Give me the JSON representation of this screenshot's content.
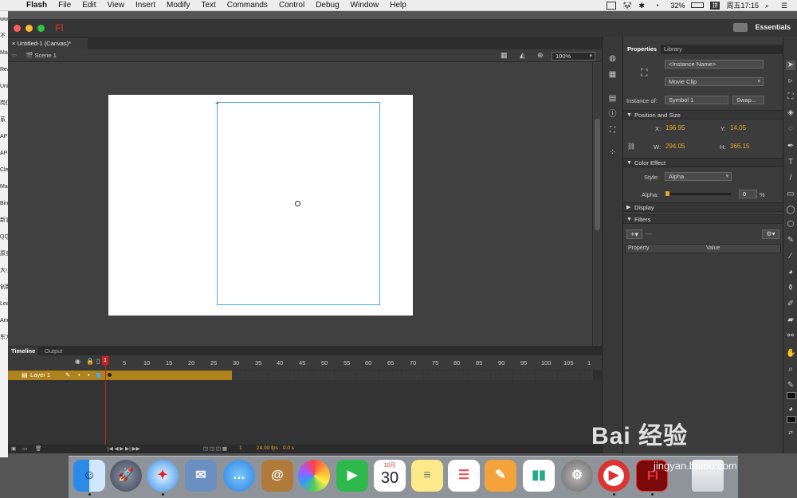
{
  "menubar": {
    "app_name": "Flash",
    "items": [
      "File",
      "Edit",
      "View",
      "Insert",
      "Modify",
      "Text",
      "Commands",
      "Control",
      "Debug",
      "Window",
      "Help"
    ],
    "battery": "32%",
    "clock": "周五17:15"
  },
  "desktop_left": [
    "ww",
    "不",
    "Ma",
    "Rea",
    "Uni",
    "岗位",
    "系",
    "APP",
    "APP",
    "Cle",
    "Ma",
    "Bin",
    "新浪",
    "QQ",
    "原实",
    "大小",
    "创新",
    "Lea",
    "Ane",
    "东方"
  ],
  "window": {
    "app_logo": "Fl",
    "workspace": "Essentials"
  },
  "document": {
    "tab_title": "Untitled-1 (Canvas)*",
    "scene": "Scene 1",
    "zoom": "100%"
  },
  "timeline": {
    "tabs": [
      "Timeline",
      "Output"
    ],
    "frame_numbers": [
      "1",
      "5",
      "10",
      "15",
      "20",
      "25",
      "30",
      "35",
      "40",
      "45",
      "50",
      "55",
      "60",
      "65",
      "70",
      "75",
      "80",
      "85",
      "90",
      "95",
      "100",
      "105",
      "1"
    ],
    "layer_name": "Layer 1",
    "current_frame": "1",
    "fps": "24.00 fps",
    "seconds": "0.0 s"
  },
  "properties": {
    "tabs": [
      "Properties",
      "Library"
    ],
    "instance_name_placeholder": "<Instance Name>",
    "symbol_type": "Movie Clip",
    "instance_of_label": "Instance of:",
    "instance_of": "Symbol 1",
    "swap_label": "Swap...",
    "position_size_header": "Position and Size",
    "x_label": "X:",
    "x": "196.95",
    "y_label": "Y:",
    "y": "14.05",
    "w_label": "W:",
    "w": "294.05",
    "h_label": "H:",
    "h": "366.15",
    "color_effect_header": "Color Effect",
    "style_label": "Style:",
    "style": "Alpha",
    "alpha_label": "Alpha:",
    "alpha_value": "0",
    "alpha_unit": "%",
    "display_header": "Display",
    "filters_header": "Filters",
    "filter_col_property": "Property",
    "filter_col_value": "Value"
  },
  "dock": {
    "calendar_month": "10月",
    "calendar_day": "30"
  },
  "watermark": {
    "brand": "Bai 经验",
    "site": "jingyan.baidu.com"
  },
  "colors": {
    "accent_orange": "#e6a628",
    "layer_selected": "#b0821c",
    "playhead": "#c81e1e",
    "selection_blue": "#4aa8e8"
  }
}
